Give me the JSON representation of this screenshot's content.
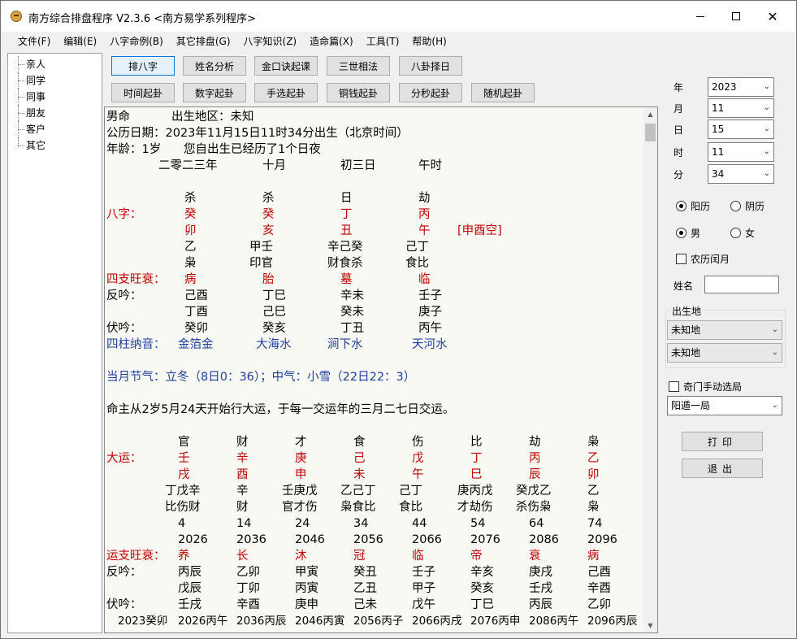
{
  "window": {
    "title": "南方综合排盘程序 V2.3.6    <南方易学系列程序>"
  },
  "menu": [
    "文件(F)",
    "编辑(E)",
    "八字命例(B)",
    "其它排盘(G)",
    "八字知识(Z)",
    "造命篇(X)",
    "工具(T)",
    "帮助(H)"
  ],
  "tree": [
    "亲人",
    "同学",
    "同事",
    "朋友",
    "客户",
    "其它"
  ],
  "toolbar_row1": [
    "排八字",
    "姓名分析",
    "金口诀起课",
    "三世相法",
    "八卦择日"
  ],
  "toolbar_row2": [
    "时间起卦",
    "数字起卦",
    "手选起卦",
    "铜钱起卦",
    "分秒起卦",
    "随机起卦"
  ],
  "chart": {
    "l1a": "男命",
    "l1b": "出生地区：未知",
    "l2": "公历日期：2023年11月15日11时34分出生（北京时间）",
    "l3a": "年龄：1岁",
    "l3b": "您自出生已经历了1个日夜",
    "l4": [
      "二零二三年",
      "十月",
      "初三日",
      "午时"
    ],
    "gods": [
      "杀",
      "杀",
      "日",
      "劫"
    ],
    "bazi_label": "八字：",
    "stems": [
      "癸",
      "癸",
      "丁",
      "丙"
    ],
    "branches": [
      "卯",
      "亥",
      "丑",
      "午"
    ],
    "kong": "[申酉空]",
    "hidden": [
      "乙",
      "甲壬",
      "辛己癸",
      "己丁"
    ],
    "hidden_gods": [
      "枭",
      "印官",
      "财食杀",
      "食比"
    ],
    "wangshuai_label": "四支旺衰：",
    "wangshuai": [
      "病",
      "胎",
      "墓",
      "临"
    ],
    "fanyin_label": "反吟：",
    "fanyin1": [
      "己酉",
      "丁巳",
      "辛未",
      "壬子"
    ],
    "fanyin2": [
      "丁酉",
      "己巳",
      "癸未",
      "庚子"
    ],
    "fuyin_label": "伏吟：",
    "fuyin": [
      "癸卯",
      "癸亥",
      "丁丑",
      "丙午"
    ],
    "nayin_label": "四柱纳音：",
    "nayin": [
      "金箔金",
      "大海水",
      "涧下水",
      "天河水"
    ],
    "jieqi": "当月节气：立冬（8日0：36）；中气：小雪（22日22：3）",
    "dayun_intro": "命主从2岁5月24天开始行大运，于每一交运年的三月二七日交运。",
    "dy_gods": [
      "官",
      "财",
      "才",
      "食",
      "伤",
      "比",
      "劫",
      "枭"
    ],
    "dy_label": "大运：",
    "dy_stems": [
      "壬",
      "辛",
      "庚",
      "己",
      "戊",
      "丁",
      "丙",
      "乙"
    ],
    "dy_branches": [
      "戌",
      "酉",
      "申",
      "未",
      "午",
      "巳",
      "辰",
      "卯"
    ],
    "dy_hidden": [
      "丁戊辛",
      "辛",
      "壬庚戊",
      "乙己丁",
      "己丁",
      "庚丙戊",
      "癸戊乙",
      "乙"
    ],
    "dy_hidden_gods": [
      "比伤财",
      "财",
      "官才伤",
      "枭食比",
      "食比",
      "才劫伤",
      "杀伤枭",
      "枭"
    ],
    "dy_ages": [
      "4",
      "14",
      "24",
      "34",
      "44",
      "54",
      "64",
      "74"
    ],
    "dy_years": [
      "2026",
      "2036",
      "2046",
      "2056",
      "2066",
      "2076",
      "2086",
      "2096"
    ],
    "dy_ws_label": "运支旺衰：",
    "dy_ws": [
      "养",
      "长",
      "沐",
      "冠",
      "临",
      "帝",
      "衰",
      "病"
    ],
    "dy_fan_label": "反吟：",
    "dy_fan1": [
      "丙辰",
      "乙卯",
      "甲寅",
      "癸丑",
      "壬子",
      "辛亥",
      "庚戌",
      "己酉"
    ],
    "dy_fan2": [
      "戊辰",
      "丁卯",
      "丙寅",
      "乙丑",
      "甲子",
      "癸亥",
      "壬戌",
      "辛酉"
    ],
    "dy_fu_label": "伏吟：",
    "dy_fu": [
      "壬戌",
      "辛酉",
      "庚申",
      "己未",
      "戊午",
      "丁巳",
      "丙辰",
      "乙卯"
    ],
    "last_row": [
      "2023癸卯",
      "2026丙午",
      "2036丙辰",
      "2046丙寅",
      "2056丙子",
      "2066丙戌",
      "2076丙申",
      "2086丙午",
      "2096丙辰"
    ]
  },
  "right_panel": {
    "year_label": "年",
    "year_value": "2023",
    "month_label": "月",
    "month_value": "11",
    "day_label": "日",
    "day_value": "15",
    "hour_label": "时",
    "hour_value": "11",
    "minute_label": "分",
    "minute_value": "34",
    "solar_label": "阳历",
    "lunar_label": "阴历",
    "male_label": "男",
    "female_label": "女",
    "leap_label": "农历闰月",
    "name_label": "姓名",
    "birthplace_label": "出生地",
    "place1": "未知地",
    "place2": "未知地",
    "qimen_label": "奇门手动选局",
    "ju_value": "阳遁一局",
    "print_label": "打印",
    "exit_label": "退出"
  }
}
